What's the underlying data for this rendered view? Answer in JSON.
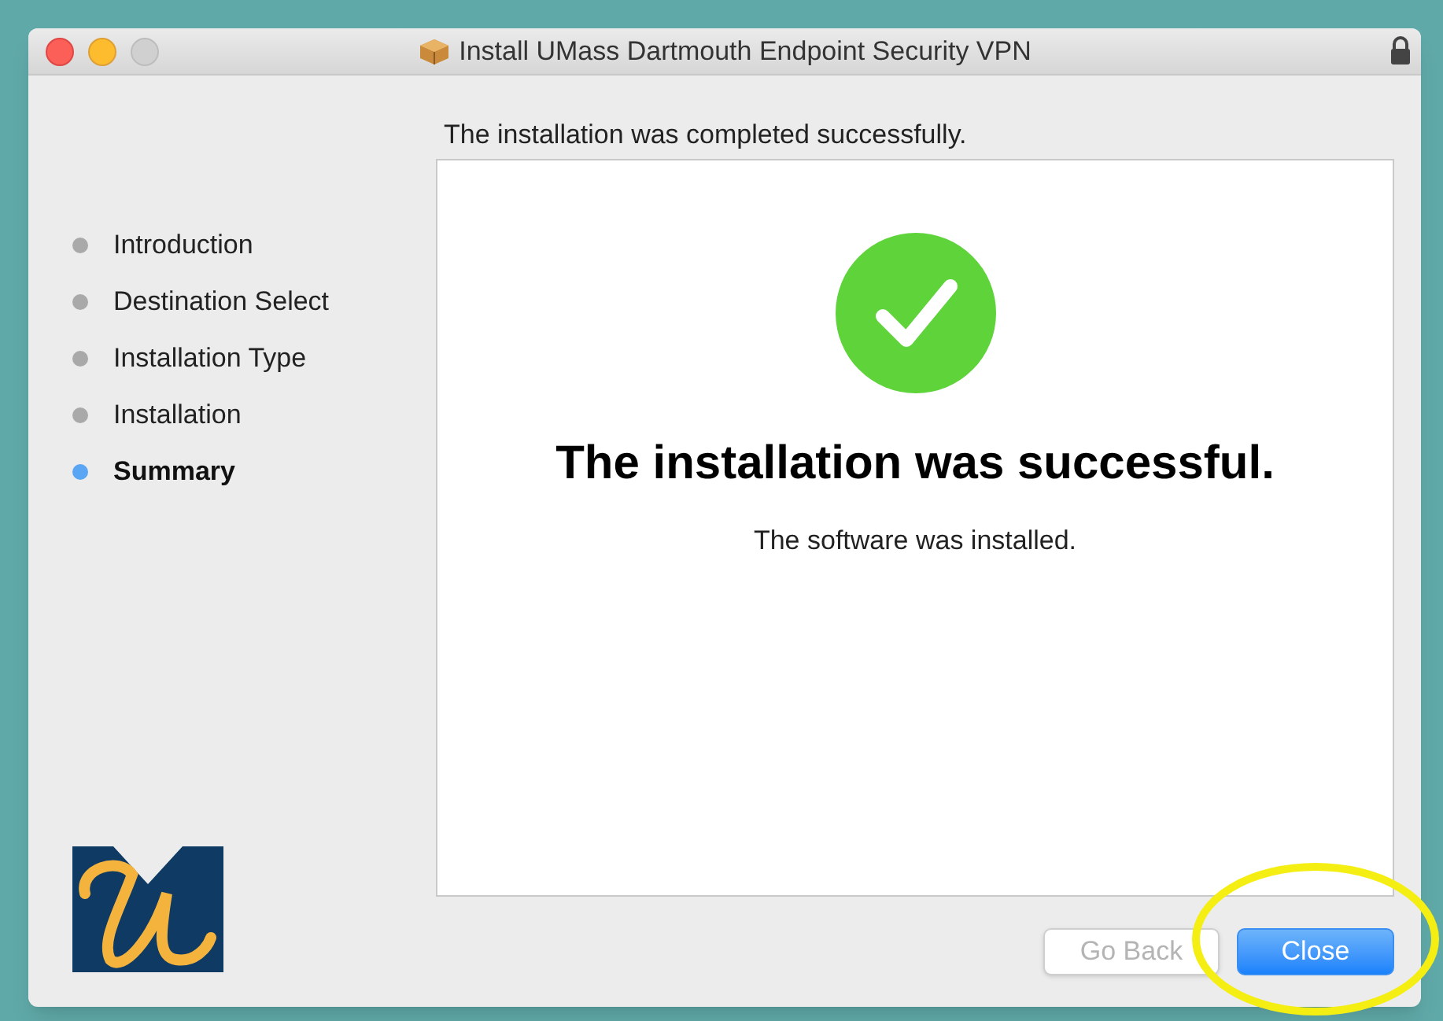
{
  "window": {
    "title": "Install UMass Dartmouth Endpoint Security VPN"
  },
  "heading": "The installation was completed successfully.",
  "steps": [
    {
      "label": "Introduction",
      "selected": false
    },
    {
      "label": "Destination Select",
      "selected": false
    },
    {
      "label": "Installation Type",
      "selected": false
    },
    {
      "label": "Installation",
      "selected": false
    },
    {
      "label": "Summary",
      "selected": true
    }
  ],
  "result": {
    "title": "The installation was successful.",
    "message": "The software was installed."
  },
  "buttons": [
    {
      "label": "Go Back",
      "disabled": true,
      "default": false
    },
    {
      "label": "Close",
      "disabled": false,
      "default": true
    }
  ]
}
